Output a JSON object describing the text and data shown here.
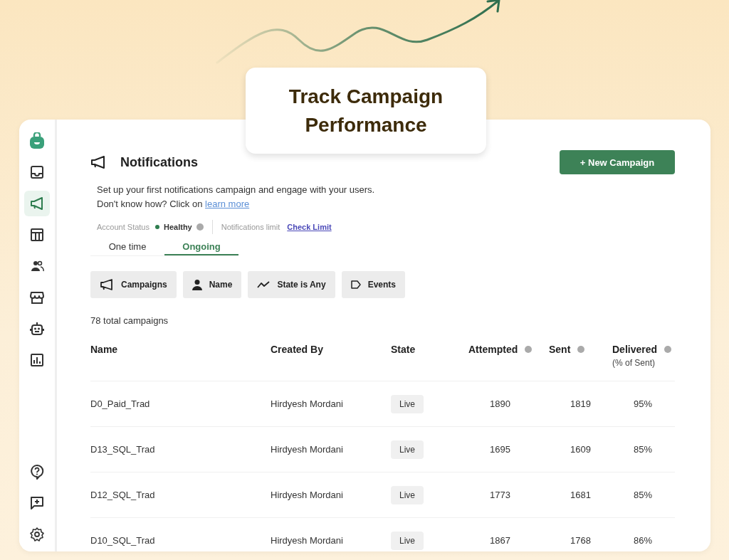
{
  "headline": {
    "text": "Track Campaign Performance"
  },
  "sidebar": {
    "top": [
      {
        "selected": false
      },
      {
        "selected": false
      },
      {
        "selected": true
      },
      {
        "selected": false
      },
      {
        "selected": false
      },
      {
        "selected": false
      },
      {
        "selected": false
      },
      {
        "selected": false
      }
    ],
    "bottom": [
      {
        "selected": false
      },
      {
        "selected": false
      },
      {
        "selected": false
      }
    ]
  },
  "page": {
    "title": "Notifications",
    "new_button": "+ New Campaign",
    "description": "Set up your first notifications campaign and engage with your users.",
    "help_text": "Don't know how? Click on",
    "help_link": "learn more",
    "account_status": {
      "label": "Account Status",
      "value": "Healthy",
      "color": "#2e7d4f"
    },
    "limit": {
      "label": "Notifications limit",
      "link": "Check Limit"
    }
  },
  "tabs": [
    {
      "label": "One time",
      "selected": false
    },
    {
      "label": "Ongoing",
      "selected": true
    }
  ],
  "filters": [
    {
      "label": "Campaigns"
    },
    {
      "label": "Name"
    },
    {
      "label": "State is Any"
    },
    {
      "label": "Events"
    }
  ],
  "total": "78 total campaigns",
  "table": {
    "columns": [
      {
        "label": "Name",
        "info": false
      },
      {
        "label": "Created By",
        "info": false
      },
      {
        "label": "State",
        "info": false
      },
      {
        "label": "Attempted",
        "info": true
      },
      {
        "label": "Sent",
        "info": true
      },
      {
        "label": "Delivered",
        "info": true,
        "sublabel": "(% of Sent)"
      }
    ],
    "rows": [
      [
        "D0_Paid_Trad",
        "Hirdyesh Mordani",
        "Live",
        "1890",
        "1819",
        "95%"
      ],
      [
        "D13_SQL_Trad",
        "Hirdyesh Mordani",
        "Live",
        "1695",
        "1609",
        "85%"
      ],
      [
        "D12_SQL_Trad",
        "Hirdyesh Mordani",
        "Live",
        "1773",
        "1681",
        "85%"
      ],
      [
        "D10_SQL_Trad",
        "Hirdyesh Mordani",
        "Live",
        "1867",
        "1768",
        "86%"
      ]
    ]
  }
}
